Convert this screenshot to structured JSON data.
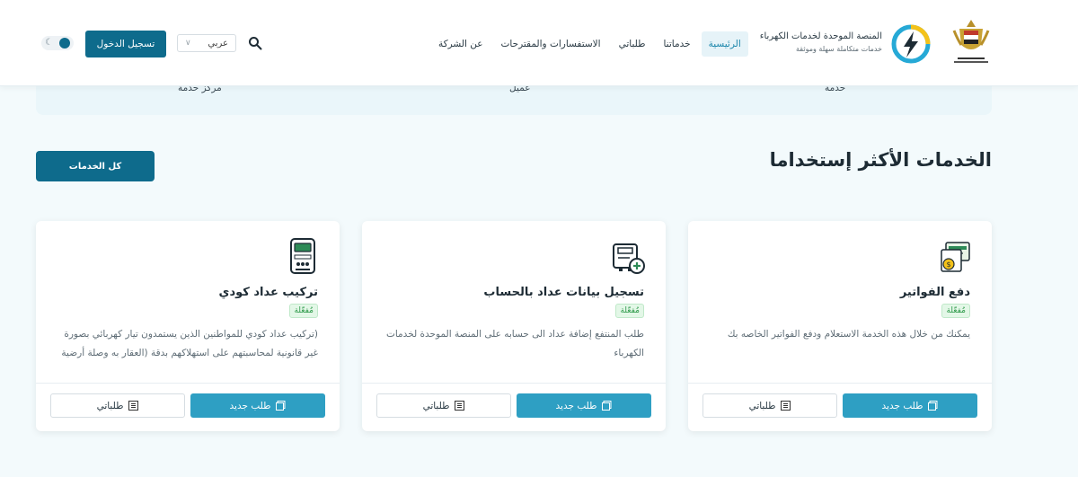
{
  "header": {
    "brand_title": "المنصة الموحدة لخدمات الكهرباء",
    "brand_subtitle": "خدمات متكاملة سهلة وموثقة",
    "nav": [
      "الرئيسية",
      "خدماتنا",
      "طلباتي",
      "الاستفسارات والمقترحات",
      "عن الشركة"
    ],
    "active_nav": "الرئيسية",
    "language": "عربي",
    "login_label": "تسجيل الدخول",
    "colors": {
      "primary": "#0e6b8c",
      "accent": "#2e9fc3"
    }
  },
  "stats": [
    "خدمة",
    "عميل",
    "مركز خدمة"
  ],
  "section": {
    "title": "الخدمات الأكثر إستخداما",
    "all_services_label": "كل الخدمات"
  },
  "cards": [
    {
      "icon": "bill-payment-icon",
      "title": "دفع الفواتير",
      "badge": "مُفعّلة",
      "description": "يمكنك من خلال هذه الخدمة الاستعلام ودفع الفواتير الخاصه بك",
      "new_request_label": "طلب جديد",
      "my_orders_label": "طلباتي"
    },
    {
      "icon": "meter-register-icon",
      "title": "تسجيل بيانات عداد بالحساب",
      "badge": "مُفعّلة",
      "description": "طلب المنتفع إضافة عداد الى حسابه على المنصة الموحدة لخدمات الكهرباء",
      "new_request_label": "طلب جديد",
      "my_orders_label": "طلباتي"
    },
    {
      "icon": "coded-meter-icon",
      "title": "تركيب عداد كودي",
      "badge": "مُفعّلة",
      "description": "(تركيب عداد كودي للمواطنين الذين يستمدون تيار كهربائي بصورة غير قانونية لمحاسبتهم على استهلاكهم بدقة (العقار به وصلة أرضية",
      "new_request_label": "طلب جديد",
      "my_orders_label": "طلباتي"
    }
  ]
}
